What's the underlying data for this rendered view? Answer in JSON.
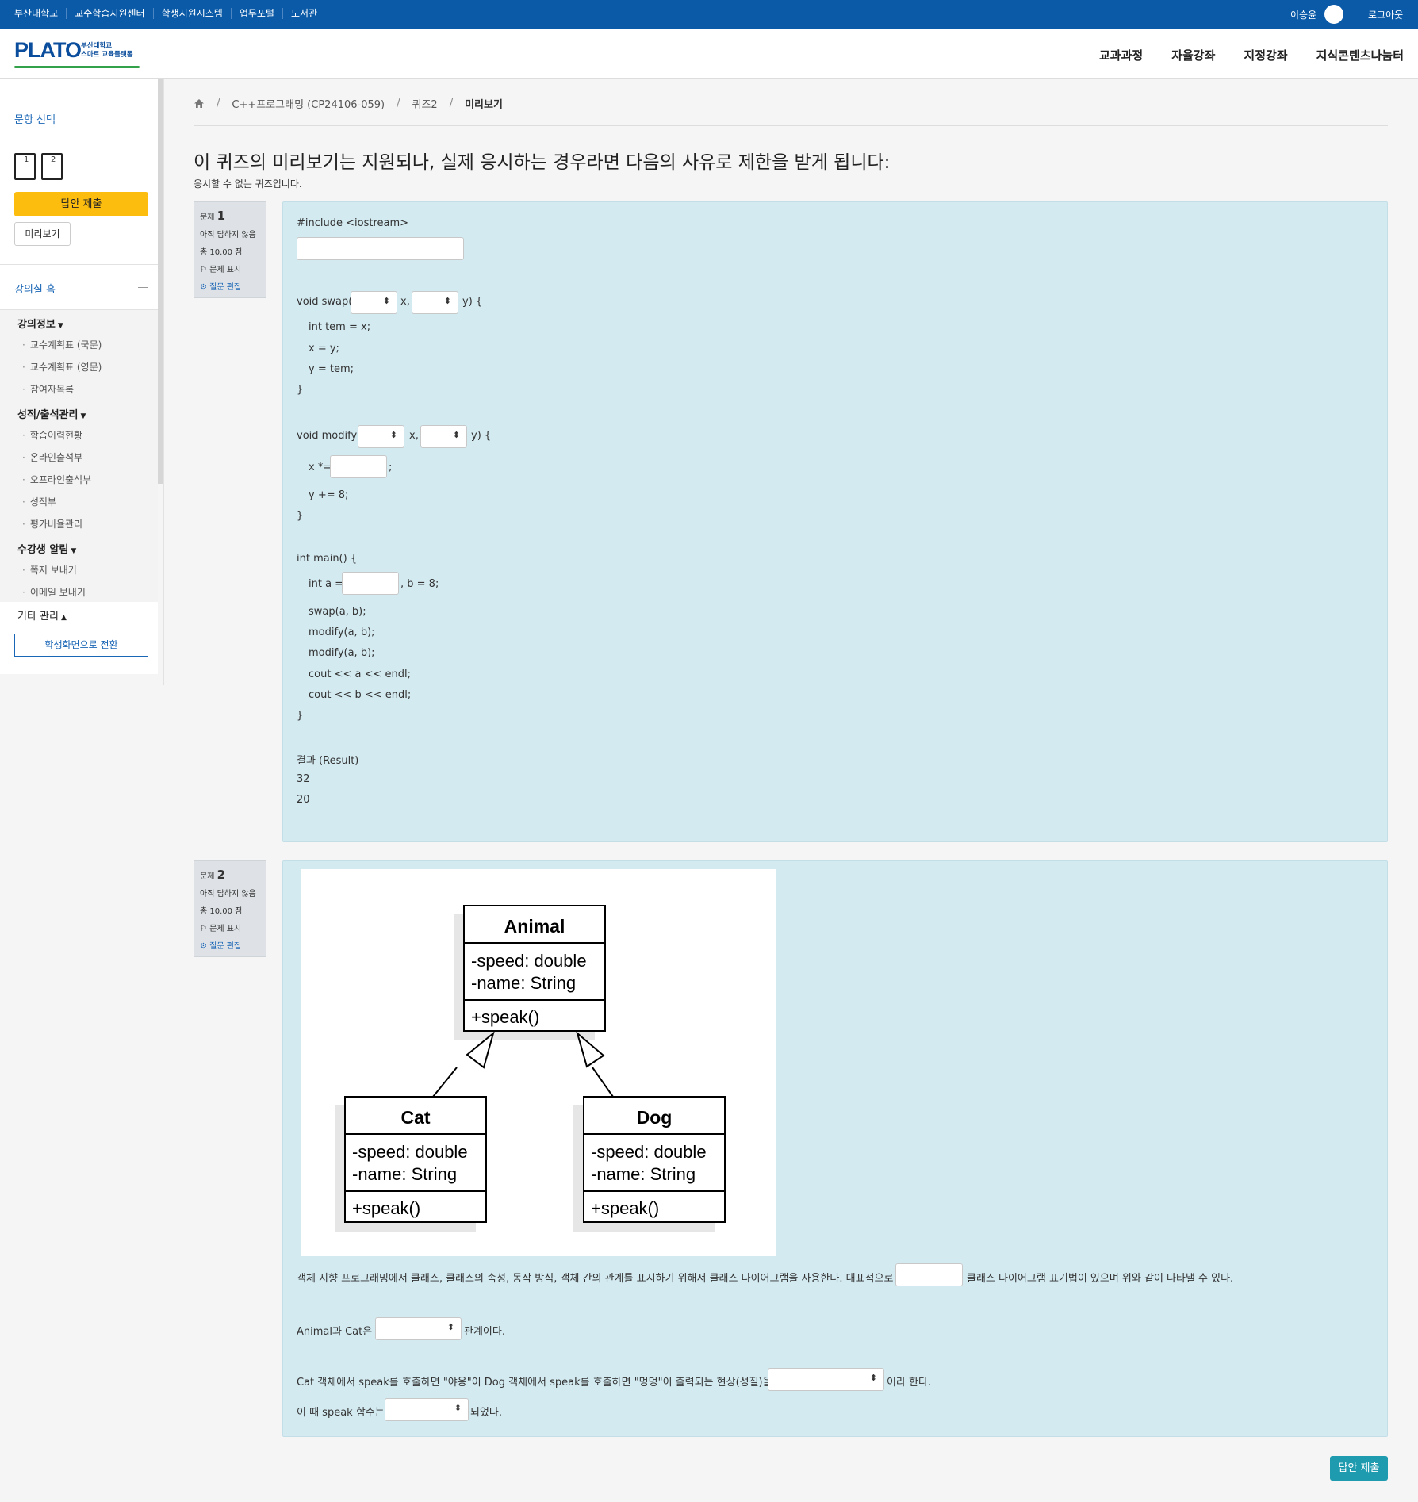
{
  "topbar": {
    "links": [
      "부산대학교",
      "교수학습지원센터",
      "학생지원시스템",
      "업무포털",
      "도서관"
    ],
    "user_name": "이승윤",
    "logout": "로그아웃"
  },
  "logo": {
    "word": "PLATO",
    "sub1": "부산대학교",
    "sub2": "스마트 교육플랫폼"
  },
  "main_nav": [
    "교과과정",
    "자율강좌",
    "지정강좌",
    "지식콘텐츠나눔터"
  ],
  "sidebar": {
    "question_select": "문항 선택",
    "question_buttons": [
      "1",
      "2"
    ],
    "submit_label": "답안 제출",
    "preview_label": "미리보기",
    "course_home": "강의실 홈",
    "groups": [
      {
        "title": "강의정보",
        "items": [
          "교수계획표 (국문)",
          "교수계획표 (영문)",
          "참여자목록"
        ]
      },
      {
        "title": "성적/출석관리",
        "items": [
          "학습이력현황",
          "온라인출석부",
          "오프라인출석부",
          "성적부",
          "평가비율관리"
        ]
      },
      {
        "title": "수강생 알림",
        "items": [
          "쪽지 보내기",
          "이메일 보내기"
        ]
      },
      {
        "title": "기타 관리",
        "items": []
      }
    ],
    "switch_label": "학생화면으로 전환"
  },
  "breadcrumb": [
    "C++프로그래밍 (CP24106-059)",
    "퀴즈2",
    "미리보기"
  ],
  "notice": {
    "title": "이 퀴즈의 미리보기는 지원되나, 실제 응시하는 경우라면 다음의 사유로 제한을 받게 됩니다:",
    "subtitle": "응시할 수 없는 퀴즈입니다."
  },
  "questions": [
    {
      "label": "문제",
      "number": "1",
      "status": "아직 답하지 않음",
      "points": "총 10.00 점",
      "flag": "문제 표시",
      "edit": "질문 편집"
    },
    {
      "label": "문제",
      "number": "2",
      "status": "아직 답하지 않음",
      "points": "총 10.00 점",
      "flag": "문제 표시",
      "edit": "질문 편집"
    }
  ],
  "q1_code": {
    "include": "#include <iostream>",
    "swap_pre": "void swap(",
    "swap_mid": "x,",
    "swap_post": "y) {",
    "swap_body": [
      "int tem = x;",
      "x = y;",
      "y = tem;"
    ],
    "close": "}",
    "modify_pre": "void modify(",
    "modify_mid": "x,",
    "modify_post": "y) {",
    "modify_x_pre": "x *=",
    "modify_x_post": ";",
    "modify_y": "y += 8;",
    "main_open": "int main() {",
    "main_a_pre": "int a =",
    "main_a_post": ", b = 8;",
    "main_body": [
      "swap(a, b);",
      "modify(a, b);",
      "modify(a, b);",
      "cout << a << endl;",
      "cout << b << endl;"
    ],
    "result_label": "결과 (Result)",
    "result_values": [
      "32",
      "20"
    ]
  },
  "q2_diagram": {
    "classes": [
      {
        "name": "Animal",
        "attributes": [
          "-speed: double",
          "-name: String"
        ],
        "methods": [
          "+speak()"
        ]
      },
      {
        "name": "Cat",
        "attributes": [
          "-speed: double",
          "-name: String"
        ],
        "methods": [
          "+speak()"
        ]
      },
      {
        "name": "Dog",
        "attributes": [
          "-speed: double",
          "-name: String"
        ],
        "methods": [
          "+speak()"
        ]
      }
    ]
  },
  "q2_text": {
    "line1_pre": "객체 지향 프로그래밍에서 클래스, 클래스의 속성, 동작 방식, 객체 간의 관계를 표시하기 위해서 클래스 다이어그램을 사용한다. 대표적으로",
    "line1_post": "클래스 다이어그램 표기법이 있으며 위와 같이 나타낼 수 있다.",
    "line2_pre": "Animal과 Cat은",
    "line2_post": "관계이다.",
    "line3_pre": "Cat 객체에서 speak를 호출하면 \"야옹\"이 Dog 객체에서 speak를 호출하면 \"멍멍\"이 출력되는 현상(성질)을",
    "line3_post": "이라 한다.",
    "line4_pre": "이 때 speak 함수는",
    "line4_post": "되었다."
  },
  "final_submit": "답안 제출"
}
